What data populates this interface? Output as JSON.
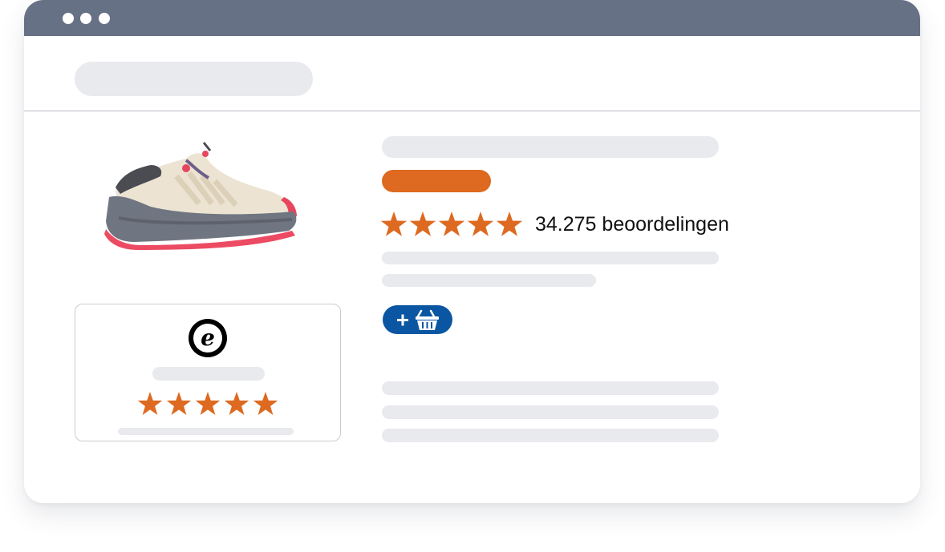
{
  "product": {
    "review_count_text": "34.275 beoordelingen",
    "rating_stars": 5,
    "badge_color": "#dd6a20",
    "star_color": "#dd6a20"
  },
  "trust_card": {
    "logo_letter": "e",
    "rating_stars": 5
  },
  "cart_button": {
    "icons": [
      "plus-icon",
      "shopping-basket-icon"
    ],
    "color": "#0a56a2"
  },
  "titlebar": {
    "color": "#677186",
    "window_controls": [
      "window-dot-icon",
      "window-dot-icon",
      "window-dot-icon"
    ]
  }
}
